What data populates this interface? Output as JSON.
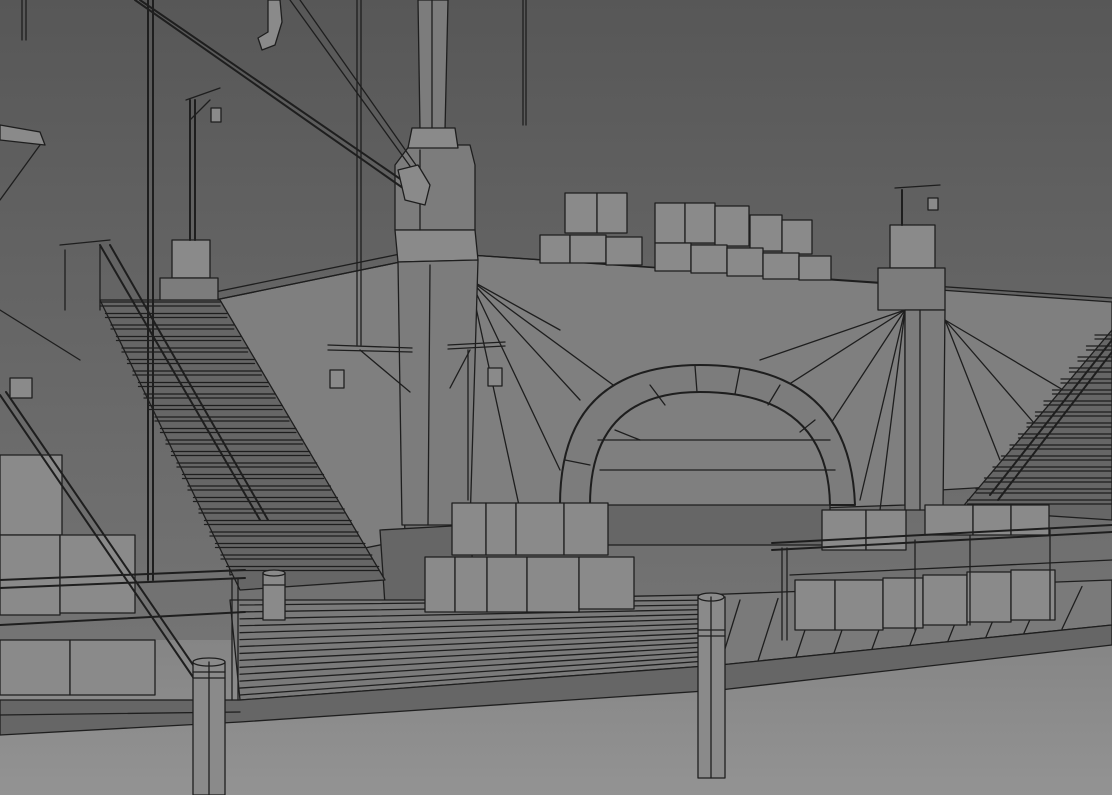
{
  "scene": {
    "subject": "wireframe-harbor-dock",
    "colors": {
      "sky_top": "#575757",
      "sky_bottom": "#7b7b7b",
      "ground": "#8c8c8c",
      "wire": "#1e1e1e"
    }
  }
}
